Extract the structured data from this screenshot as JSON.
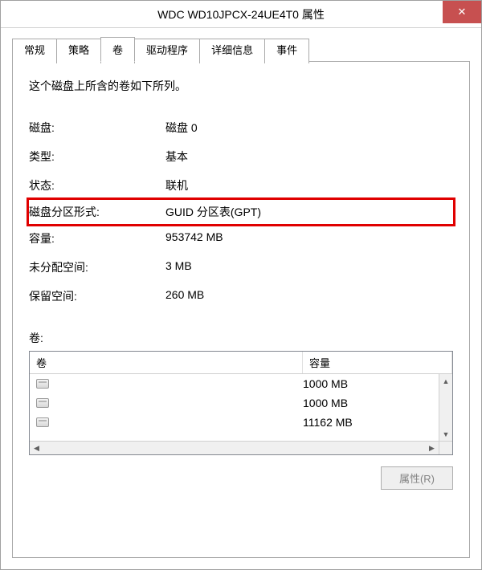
{
  "window": {
    "title": "WDC WD10JPCX-24UE4T0 属性",
    "close_symbol": "✕"
  },
  "tabs": [
    {
      "label": "常规"
    },
    {
      "label": "策略"
    },
    {
      "label": "卷",
      "active": true
    },
    {
      "label": "驱动程序"
    },
    {
      "label": "详细信息"
    },
    {
      "label": "事件"
    }
  ],
  "volumes_tab": {
    "intro": "这个磁盘上所含的卷如下所列。",
    "properties": [
      {
        "label": "磁盘:",
        "value": "磁盘 0"
      },
      {
        "label": "类型:",
        "value": "基本"
      },
      {
        "label": "状态:",
        "value": "联机"
      },
      {
        "label": "磁盘分区形式:",
        "value": "GUID 分区表(GPT)",
        "highlight": true
      },
      {
        "label": "容量:",
        "value": "953742 MB"
      },
      {
        "label": "未分配空间:",
        "value": "3 MB"
      },
      {
        "label": "保留空间:",
        "value": "260 MB"
      }
    ],
    "volumes_label": "卷:",
    "columns": {
      "name": "卷",
      "capacity": "容量"
    },
    "volumes": [
      {
        "name": "",
        "capacity": "1000 MB"
      },
      {
        "name": "",
        "capacity": "1000 MB"
      },
      {
        "name": "",
        "capacity": "11162 MB"
      }
    ],
    "properties_button": "属性(R)"
  }
}
